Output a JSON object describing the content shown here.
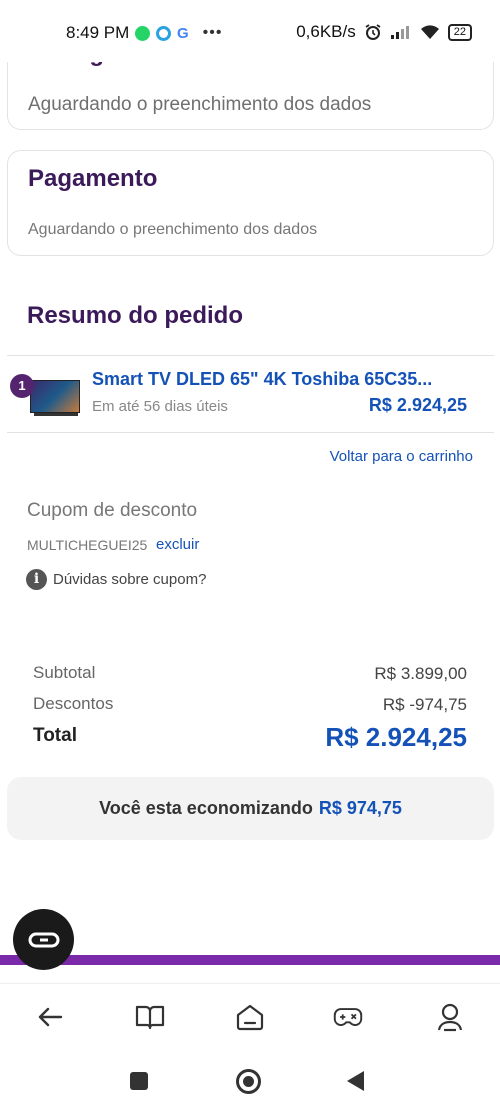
{
  "status_bar": {
    "time": "8:49 PM",
    "app_g": "G",
    "more": "•••",
    "network_speed": "0,6KB/s",
    "battery": "22"
  },
  "delivery": {
    "title": "Entrega",
    "status": "Aguardando o preenchimento dos dados"
  },
  "payment": {
    "title": "Pagamento",
    "status": "Aguardando o preenchimento dos dados"
  },
  "order_summary": {
    "title": "Resumo do pedido",
    "item": {
      "quantity": "1",
      "name": "Smart TV DLED 65\" 4K Toshiba 65C35...",
      "delivery": "Em até 56 dias úteis",
      "price": "R$ 2.924,25"
    },
    "back_to_cart": "Voltar para o carrinho"
  },
  "coupon": {
    "title": "Cupom de desconto",
    "code": "MULTICHEGUEI25",
    "remove_label": "excluir",
    "help": "Dúvidas sobre cupom?"
  },
  "totals": {
    "subtotal_label": "Subtotal",
    "subtotal_value": "R$ 3.899,00",
    "discount_label": "Descontos",
    "discount_value": "R$ -974,75",
    "total_label": "Total",
    "total_value": "R$ 2.924,25"
  },
  "savings": {
    "text": "Você esta economizando",
    "amount": "R$ 974,75"
  },
  "colors": {
    "brand_purple": "#7a2aa8",
    "title_purple": "#3b1a5a",
    "link_blue": "#1452b8"
  },
  "bottom_nav": {
    "icons": [
      "back-arrow-icon",
      "book-icon",
      "home-icon",
      "gamepad-icon",
      "profile-icon"
    ]
  }
}
